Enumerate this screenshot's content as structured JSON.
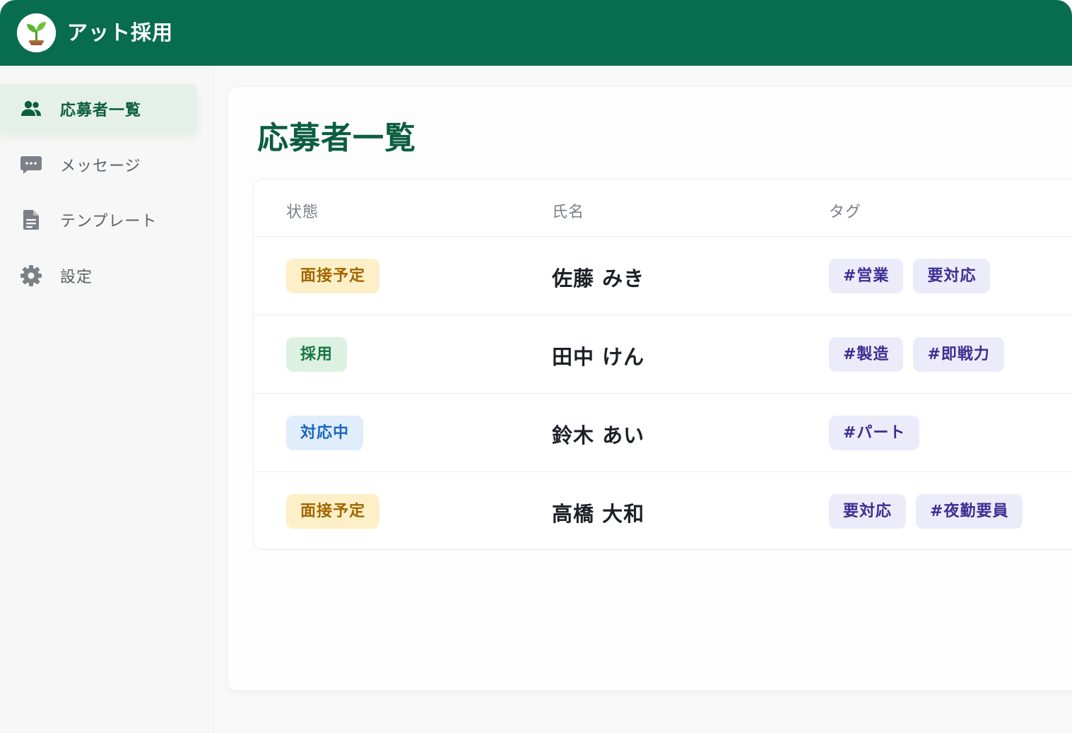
{
  "app": {
    "title": "アット採用",
    "logo_icon": "seedling-icon"
  },
  "colors": {
    "brand": "#086d4c",
    "accent_text": "#0b5e3f",
    "status_interview_bg": "#fdf0c8",
    "status_interview_text": "#a36600",
    "status_hired_bg": "#ddf1e3",
    "status_hired_text": "#17763f",
    "status_inprogress_bg": "#e0edfb",
    "status_inprogress_text": "#1c66c0",
    "tag_bg": "#ecebfa",
    "tag_text": "#3b2e92"
  },
  "sidebar": {
    "items": [
      {
        "label": "応募者一覧",
        "icon": "users-icon",
        "active": true
      },
      {
        "label": "メッセージ",
        "icon": "chat-bubble-icon",
        "active": false
      },
      {
        "label": "テンプレート",
        "icon": "document-icon",
        "active": false
      },
      {
        "label": "設定",
        "icon": "gear-icon",
        "active": false
      }
    ]
  },
  "main": {
    "title": "応募者一覧",
    "table": {
      "columns": [
        "状態",
        "氏名",
        "タグ"
      ],
      "rows": [
        {
          "status": "面接予定",
          "status_kind": "interview",
          "name": "佐藤 みき",
          "tags": [
            "#営業",
            "要対応"
          ]
        },
        {
          "status": "採用",
          "status_kind": "hired",
          "name": "田中 けん",
          "tags": [
            "#製造",
            "#即戦力"
          ]
        },
        {
          "status": "対応中",
          "status_kind": "inprogress",
          "name": "鈴木 あい",
          "tags": [
            "#パート"
          ]
        },
        {
          "status": "面接予定",
          "status_kind": "interview",
          "name": "高橋 大和",
          "tags": [
            "要対応",
            "#夜勤要員"
          ]
        }
      ]
    }
  }
}
